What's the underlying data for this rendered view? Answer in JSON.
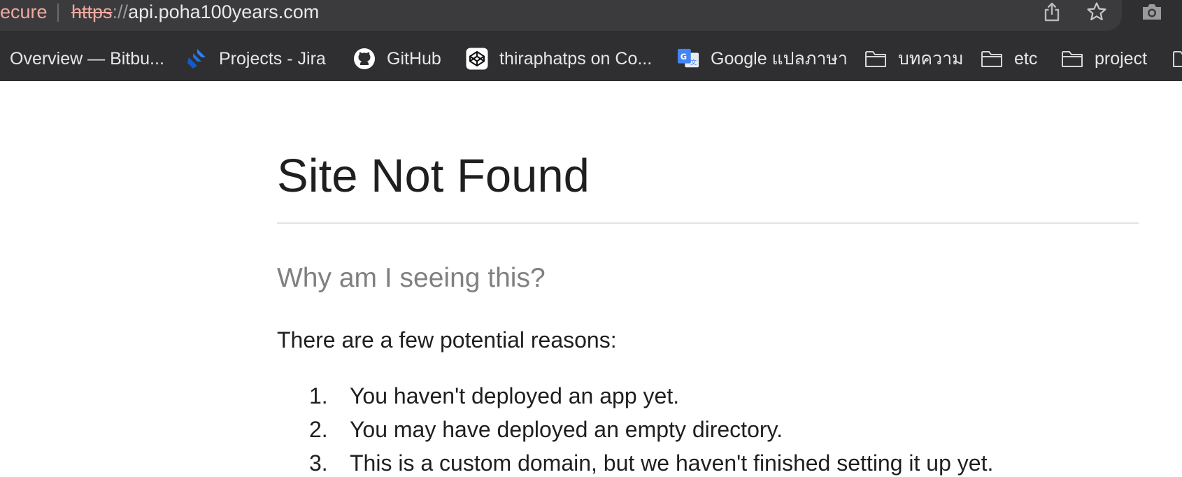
{
  "browser": {
    "address_bar": {
      "security_label": "ecure",
      "url_scheme": "https",
      "url_separator": "://",
      "url_host": "api.poha100years.com"
    },
    "toolbar_icons": [
      "share-icon",
      "star-icon",
      "camera-icon"
    ],
    "bookmarks": [
      {
        "label": "Overview — Bitbu...",
        "icon": "none"
      },
      {
        "label": "Projects - Jira",
        "icon": "jira-icon"
      },
      {
        "label": "GitHub",
        "icon": "github-icon"
      },
      {
        "label": "thiraphatps on Co...",
        "icon": "codepen-icon"
      },
      {
        "label": "Google แปลภาษา",
        "icon": "google-translate-icon"
      },
      {
        "label": "บทความ",
        "icon": "folder-icon"
      },
      {
        "label": "etc",
        "icon": "folder-icon"
      },
      {
        "label": "project",
        "icon": "folder-icon"
      }
    ]
  },
  "page": {
    "title": "Site Not Found",
    "subheading": "Why am I seeing this?",
    "intro": "There are a few potential reasons:",
    "reasons": [
      {
        "number": "1.",
        "text": "You haven't deployed an app yet."
      },
      {
        "number": "2.",
        "text": "You may have deployed an empty directory."
      },
      {
        "number": "3.",
        "text": "This is a custom domain, but we haven't finished setting it up yet."
      }
    ]
  },
  "colors": {
    "chrome_background": "#2f2f31",
    "address_bar_background": "#3b3b3d",
    "insecure_scheme": "#f2a8a0",
    "jira_blue": "#2684ff",
    "google_translate_blue": "#4285f4"
  }
}
